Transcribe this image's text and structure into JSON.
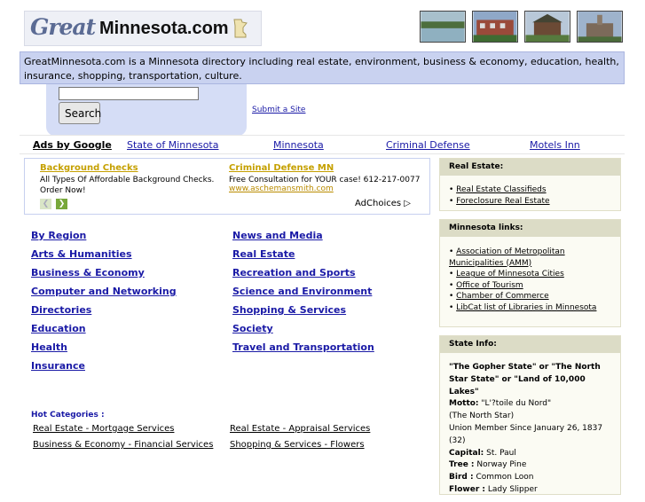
{
  "header": {
    "logo_great": "Great",
    "logo_domain": "Minnesota.com"
  },
  "description": "GreatMinnesota.com is a Minnesota directory including real estate, environment, business & economy, education, health, insurance, shopping, transportation, culture.",
  "search": {
    "value": "",
    "button": "Search",
    "submit_link": "Submit a Site"
  },
  "ads_bar": {
    "label": "Ads by Google",
    "links": [
      "State of Minnesota",
      "Minnesota",
      "Criminal Defense",
      "Motels Inn"
    ]
  },
  "ads": [
    {
      "title": "Background Checks",
      "body": "All Types Of Affordable Background Checks. Order Now!",
      "url": ""
    },
    {
      "title": "Criminal Defense MN",
      "body": "Free Consultation for YOUR case! 612-217-0077",
      "url": "www.aschemansmith.com"
    }
  ],
  "adchoices": "AdChoices",
  "categories_left": [
    "By Region",
    "Arts & Humanities",
    "Business & Economy",
    "Computer and Networking",
    "Directories",
    "Education",
    "Health",
    "Insurance"
  ],
  "categories_right": [
    "News and Media",
    "Real Estate",
    "Recreation and Sports",
    "Science and Environment",
    "Shopping & Services",
    "Society",
    "Travel and Transportation"
  ],
  "hot": {
    "title": "Hot Categories :",
    "items": [
      "Real Estate - Mortgage Services",
      "Real Estate - Appraisal Services",
      "Business & Economy - Financial Services",
      "Shopping & Services - Flowers"
    ]
  },
  "sidebar": {
    "real_estate": {
      "title": "Real Estate:",
      "links": [
        "Real Estate Classifieds",
        "Foreclosure Real Estate"
      ]
    },
    "mn_links": {
      "title": "Minnesota links:",
      "links": [
        "Association of Metropolitan Municipalities (AMM)",
        "League of Minnesota Cities",
        "Office of Tourism",
        "Chamber of Commerce",
        "LibCat list of Libraries in Minnesota"
      ]
    },
    "state_info": {
      "title": "State Info:",
      "nickname": "\"The Gopher State\" or \"The North Star State\" or \"Land of 10,000 Lakes\"",
      "motto_label": "Motto:",
      "motto": "\"L'?toile du Nord\"",
      "motto_translation": "(The North Star)",
      "union": "Union Member Since January 26, 1837 (32)",
      "capital_label": "Capital:",
      "capital": "St. Paul",
      "tree_label": "Tree :",
      "tree": "Norway Pine",
      "bird_label": "Bird :",
      "bird": "Common Loon",
      "flower_label": "Flower :",
      "flower": "Lady Slipper"
    }
  },
  "colors": {
    "link": "#1a1aa6",
    "ad_title": "#c5a000",
    "desc_bg": "#c9d2f0",
    "sidebar_head": "#dcdcc6"
  }
}
